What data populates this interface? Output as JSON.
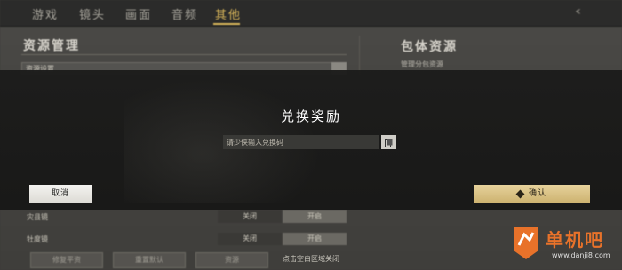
{
  "nav": {
    "tabs": [
      {
        "label": "游戏"
      },
      {
        "label": "镜头"
      },
      {
        "label": "画面"
      },
      {
        "label": "音频"
      },
      {
        "label": "其他"
      }
    ],
    "back_icon": "double-chevron-left-icon"
  },
  "left_panel": {
    "title": "资源管理",
    "select_value": "资源设置",
    "rows": [
      {
        "label": "灾县镜",
        "on": "关闭",
        "off": "开启"
      },
      {
        "label": "牡度镜",
        "on": "关闭",
        "off": "开启"
      }
    ],
    "bottom_buttons": [
      "修复平资",
      "重置默认",
      "资源"
    ]
  },
  "right_panel": {
    "title": "包体资源",
    "subtitle": "管理分包资源"
  },
  "modal": {
    "title": "兑换奖励",
    "input_placeholder": "请少侠输入兑换码",
    "input_value": "",
    "cancel_label": "取消",
    "confirm_label": "确认",
    "paste_icon": "paste-icon"
  },
  "close_hint": "点击空白区域关闭",
  "watermark": {
    "text": "单机吧",
    "url": "www.danji8.com"
  },
  "colors": {
    "accent_gold": "#d9b65a",
    "confirm_gold": "#d8c183",
    "watermark_orange": "#e8722a"
  }
}
